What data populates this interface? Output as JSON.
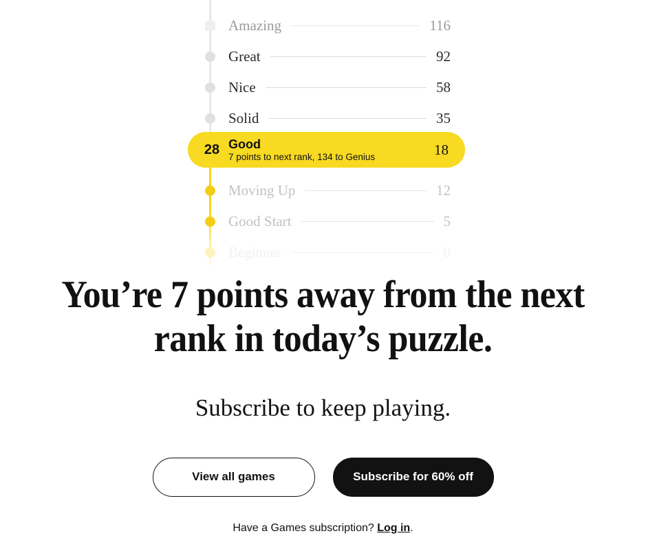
{
  "rank_ladder": {
    "current_rank_index": 4,
    "colors": {
      "highlight": "#F7DA21",
      "rail_completed": "#E8E8E8",
      "rail_upcoming": "#F5D518",
      "text": "#2B2B2B"
    },
    "rows": [
      {
        "name": "Amazing",
        "score": "116",
        "state": "fade-top"
      },
      {
        "name": "Great",
        "score": "92",
        "state": "above"
      },
      {
        "name": "Nice",
        "score": "58",
        "state": "above"
      },
      {
        "name": "Solid",
        "score": "35",
        "state": "above"
      },
      {
        "name": "Good",
        "score": "18",
        "state": "current",
        "current_score": "28",
        "subtext": "7 points to next rank, 134 to Genius"
      },
      {
        "name": "Moving Up",
        "score": "12",
        "state": "below"
      },
      {
        "name": "Good Start",
        "score": "5",
        "state": "below"
      },
      {
        "name": "Beginner",
        "score": "0",
        "state": "fade-bottom"
      }
    ]
  },
  "promo": {
    "headline": "You’re 7 points away from the next rank in today’s puzzle.",
    "subhead": "Subscribe to keep playing.",
    "view_all_games_label": "View all games",
    "subscribe_label": "Subscribe for 60% off",
    "footer_prefix": "Have a Games subscription? ",
    "footer_link": "Log in",
    "footer_suffix": "."
  }
}
